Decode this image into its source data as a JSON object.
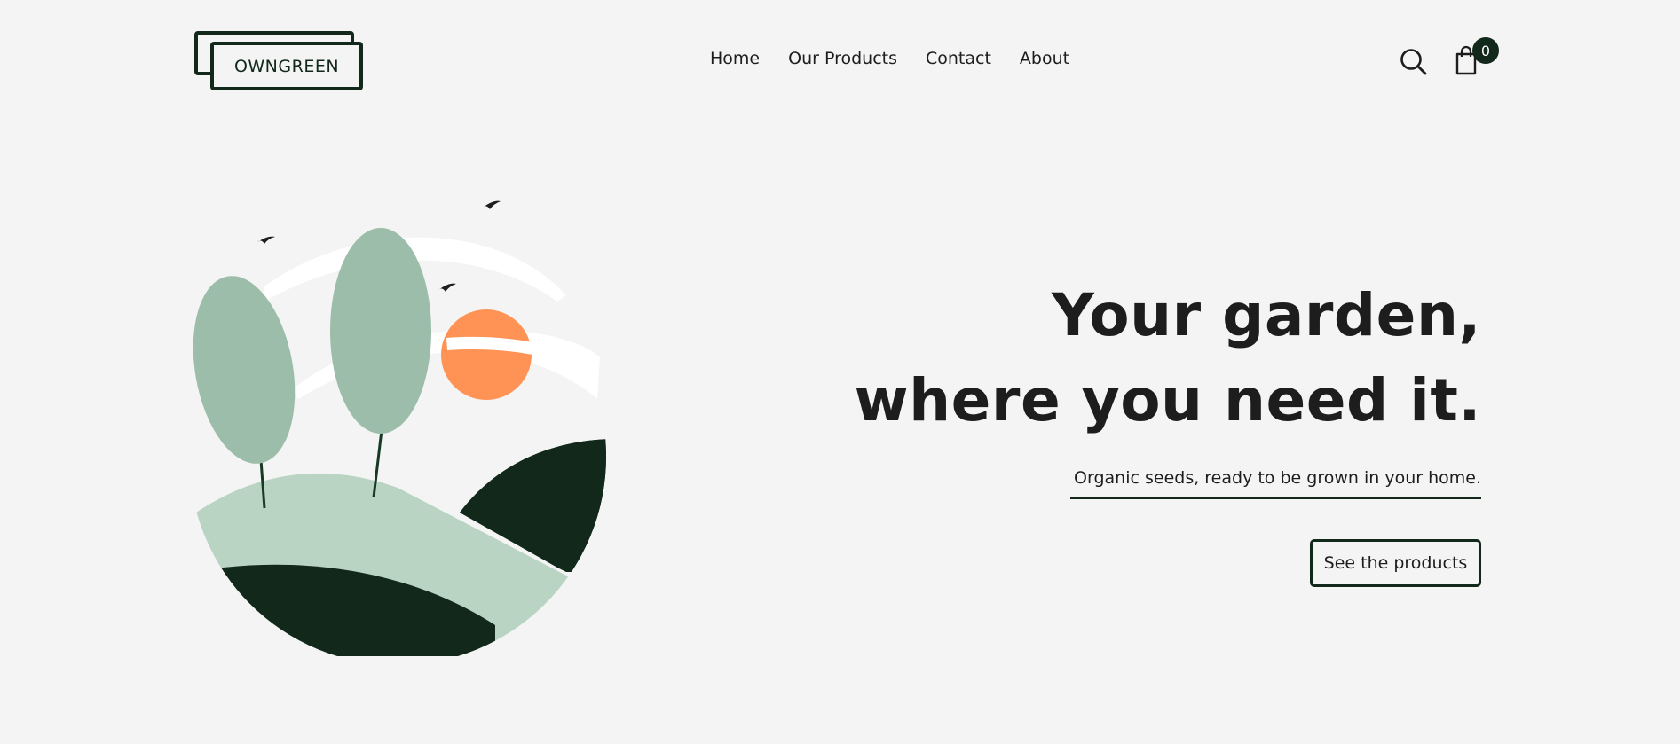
{
  "brand": {
    "logo_text": "OWNGREEN"
  },
  "nav": {
    "items": [
      {
        "label": "Home"
      },
      {
        "label": "Our Products"
      },
      {
        "label": "Contact"
      },
      {
        "label": "About"
      }
    ]
  },
  "header_actions": {
    "search_icon": "search-icon",
    "cart_icon": "shopping-bag-icon",
    "cart_count": "0"
  },
  "hero": {
    "title_line1": "Your garden,",
    "title_line2": "where you need it.",
    "subtitle": "Organic seeds, ready to be grown in your home.",
    "cta_label": "See the products"
  },
  "colors": {
    "background": "#f4f4f4",
    "dark_green": "#11281a",
    "sage": "#9bbda9",
    "light_sage": "#bad4c4",
    "sun_orange": "#ff9355",
    "text": "#1d1d1d"
  }
}
